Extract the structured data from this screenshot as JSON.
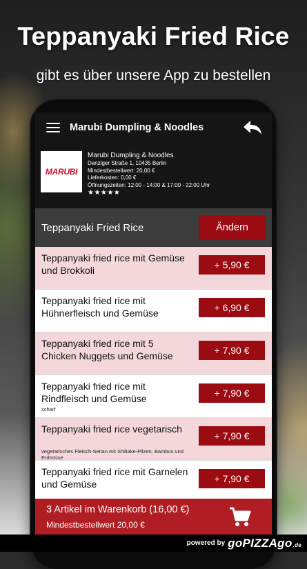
{
  "promo": {
    "headline": "Teppanyaki Fried Rice",
    "subline": "gibt es über unsere App zu bestellen"
  },
  "appbar": {
    "title": "Marubi Dumpling & Noodles"
  },
  "restaurant": {
    "logo_text": "MARUBI",
    "name": "Marubi Dumpling & Noodles",
    "address": "Danziger Straße 1, 10435 Berlin",
    "min_order": "Mindestbestellwert: 20,00 €",
    "delivery_cost": "Lieferkosten: 0,00 €",
    "opening_hours": "Öffnungszeiten: 12:00 - 14:00 & 17:00 - 22:00 Uhr",
    "rating_stars": "★★★★★",
    "rating": 5
  },
  "category": {
    "title": "Teppanyaki Fried Rice",
    "change_label": "Ändern"
  },
  "items": [
    {
      "name": "Teppanyaki fried rice mit Gemüse und Brokkoli",
      "desc": "",
      "price": "+ 5,90 €"
    },
    {
      "name": "Teppanyaki fried rice mit Hühnerfleisch und Gemüse",
      "desc": "",
      "price": "+ 6,90 €"
    },
    {
      "name": "Teppanyaki fried rice mit 5 Chicken Nuggets und Gemüse",
      "desc": "",
      "price": "+ 7,90 €"
    },
    {
      "name": "Teppanyaki fried rice mit Rindfleisch und Gemüse",
      "desc": "scharf",
      "price": "+ 7,90 €"
    },
    {
      "name": "Teppanyaki fried rice vegetarisch",
      "desc": "vegetarisches Fleisch-Seitan mit Shiitake-Pilzen, Bambus und Erdnüsse",
      "price": "+ 7,90 €"
    },
    {
      "name": "Teppanyaki fried rice mit Garnelen und Gemüse",
      "desc": "",
      "price": "+ 7,90 €"
    }
  ],
  "cart": {
    "summary": "3 Artikel im Warenkorb (16,00 €)",
    "min_order": "Mindestbestellwert 20,00 €"
  },
  "footer": {
    "powered_by": "powered by",
    "brand_prefix": "go",
    "brand_main": "PIZZA",
    "brand_go": "go",
    "brand_suffix": ".de"
  },
  "colors": {
    "accent": "#9b0b12",
    "cart": "#b01e24",
    "row_pink": "#f3d7da",
    "dark": "#151515"
  },
  "icons": {
    "menu": "hamburger-menu-icon",
    "back": "back-arrow-icon",
    "cart": "shopping-cart-icon"
  }
}
